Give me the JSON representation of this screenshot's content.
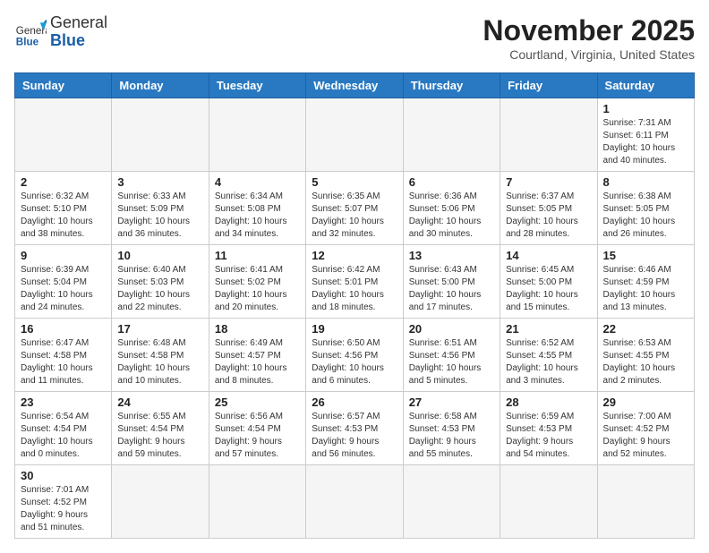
{
  "header": {
    "logo": {
      "general": "General",
      "blue": "Blue"
    },
    "title": "November 2025",
    "subtitle": "Courtland, Virginia, United States"
  },
  "weekdays": [
    "Sunday",
    "Monday",
    "Tuesday",
    "Wednesday",
    "Thursday",
    "Friday",
    "Saturday"
  ],
  "days": [
    {
      "date": "",
      "info": ""
    },
    {
      "date": "",
      "info": ""
    },
    {
      "date": "",
      "info": ""
    },
    {
      "date": "",
      "info": ""
    },
    {
      "date": "",
      "info": ""
    },
    {
      "date": "",
      "info": ""
    },
    {
      "date": "1",
      "info": "Sunrise: 7:31 AM\nSunset: 6:11 PM\nDaylight: 10 hours\nand 40 minutes."
    },
    {
      "date": "2",
      "info": "Sunrise: 6:32 AM\nSunset: 5:10 PM\nDaylight: 10 hours\nand 38 minutes."
    },
    {
      "date": "3",
      "info": "Sunrise: 6:33 AM\nSunset: 5:09 PM\nDaylight: 10 hours\nand 36 minutes."
    },
    {
      "date": "4",
      "info": "Sunrise: 6:34 AM\nSunset: 5:08 PM\nDaylight: 10 hours\nand 34 minutes."
    },
    {
      "date": "5",
      "info": "Sunrise: 6:35 AM\nSunset: 5:07 PM\nDaylight: 10 hours\nand 32 minutes."
    },
    {
      "date": "6",
      "info": "Sunrise: 6:36 AM\nSunset: 5:06 PM\nDaylight: 10 hours\nand 30 minutes."
    },
    {
      "date": "7",
      "info": "Sunrise: 6:37 AM\nSunset: 5:05 PM\nDaylight: 10 hours\nand 28 minutes."
    },
    {
      "date": "8",
      "info": "Sunrise: 6:38 AM\nSunset: 5:05 PM\nDaylight: 10 hours\nand 26 minutes."
    },
    {
      "date": "9",
      "info": "Sunrise: 6:39 AM\nSunset: 5:04 PM\nDaylight: 10 hours\nand 24 minutes."
    },
    {
      "date": "10",
      "info": "Sunrise: 6:40 AM\nSunset: 5:03 PM\nDaylight: 10 hours\nand 22 minutes."
    },
    {
      "date": "11",
      "info": "Sunrise: 6:41 AM\nSunset: 5:02 PM\nDaylight: 10 hours\nand 20 minutes."
    },
    {
      "date": "12",
      "info": "Sunrise: 6:42 AM\nSunset: 5:01 PM\nDaylight: 10 hours\nand 18 minutes."
    },
    {
      "date": "13",
      "info": "Sunrise: 6:43 AM\nSunset: 5:00 PM\nDaylight: 10 hours\nand 17 minutes."
    },
    {
      "date": "14",
      "info": "Sunrise: 6:45 AM\nSunset: 5:00 PM\nDaylight: 10 hours\nand 15 minutes."
    },
    {
      "date": "15",
      "info": "Sunrise: 6:46 AM\nSunset: 4:59 PM\nDaylight: 10 hours\nand 13 minutes."
    },
    {
      "date": "16",
      "info": "Sunrise: 6:47 AM\nSunset: 4:58 PM\nDaylight: 10 hours\nand 11 minutes."
    },
    {
      "date": "17",
      "info": "Sunrise: 6:48 AM\nSunset: 4:58 PM\nDaylight: 10 hours\nand 10 minutes."
    },
    {
      "date": "18",
      "info": "Sunrise: 6:49 AM\nSunset: 4:57 PM\nDaylight: 10 hours\nand 8 minutes."
    },
    {
      "date": "19",
      "info": "Sunrise: 6:50 AM\nSunset: 4:56 PM\nDaylight: 10 hours\nand 6 minutes."
    },
    {
      "date": "20",
      "info": "Sunrise: 6:51 AM\nSunset: 4:56 PM\nDaylight: 10 hours\nand 5 minutes."
    },
    {
      "date": "21",
      "info": "Sunrise: 6:52 AM\nSunset: 4:55 PM\nDaylight: 10 hours\nand 3 minutes."
    },
    {
      "date": "22",
      "info": "Sunrise: 6:53 AM\nSunset: 4:55 PM\nDaylight: 10 hours\nand 2 minutes."
    },
    {
      "date": "23",
      "info": "Sunrise: 6:54 AM\nSunset: 4:54 PM\nDaylight: 10 hours\nand 0 minutes."
    },
    {
      "date": "24",
      "info": "Sunrise: 6:55 AM\nSunset: 4:54 PM\nDaylight: 9 hours\nand 59 minutes."
    },
    {
      "date": "25",
      "info": "Sunrise: 6:56 AM\nSunset: 4:54 PM\nDaylight: 9 hours\nand 57 minutes."
    },
    {
      "date": "26",
      "info": "Sunrise: 6:57 AM\nSunset: 4:53 PM\nDaylight: 9 hours\nand 56 minutes."
    },
    {
      "date": "27",
      "info": "Sunrise: 6:58 AM\nSunset: 4:53 PM\nDaylight: 9 hours\nand 55 minutes."
    },
    {
      "date": "28",
      "info": "Sunrise: 6:59 AM\nSunset: 4:53 PM\nDaylight: 9 hours\nand 54 minutes."
    },
    {
      "date": "29",
      "info": "Sunrise: 7:00 AM\nSunset: 4:52 PM\nDaylight: 9 hours\nand 52 minutes."
    },
    {
      "date": "30",
      "info": "Sunrise: 7:01 AM\nSunset: 4:52 PM\nDaylight: 9 hours\nand 51 minutes."
    },
    {
      "date": "",
      "info": ""
    },
    {
      "date": "",
      "info": ""
    },
    {
      "date": "",
      "info": ""
    },
    {
      "date": "",
      "info": ""
    },
    {
      "date": "",
      "info": ""
    },
    {
      "date": "",
      "info": ""
    }
  ]
}
